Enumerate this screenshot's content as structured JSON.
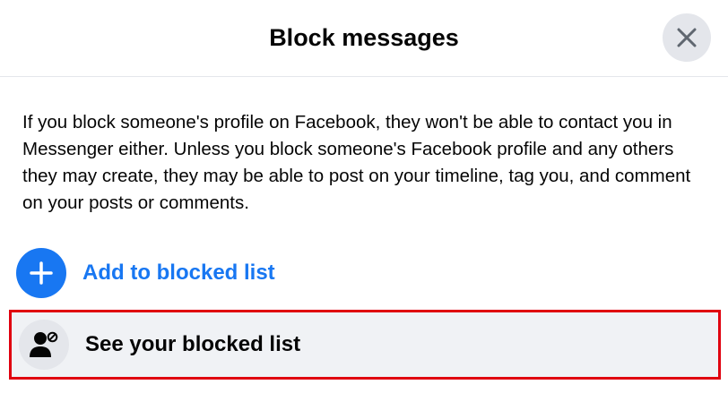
{
  "dialog": {
    "title": "Block messages",
    "close_icon": "close-icon",
    "description": "If you block someone's profile on Facebook, they won't be able to contact you in Messenger either. Unless you block someone's Facebook profile and any others they may create, they may be able to post on your timeline, tag you, and comment on your posts or comments."
  },
  "actions": {
    "add": {
      "label": "Add to blocked list",
      "icon": "plus-icon"
    },
    "see": {
      "label": "See your blocked list",
      "icon": "blocked-person-icon",
      "highlighted": true
    }
  },
  "colors": {
    "accent": "#1877f2",
    "highlight_border": "#e0000f",
    "row_background": "#f0f2f5",
    "icon_circle": "#e4e6eb"
  }
}
